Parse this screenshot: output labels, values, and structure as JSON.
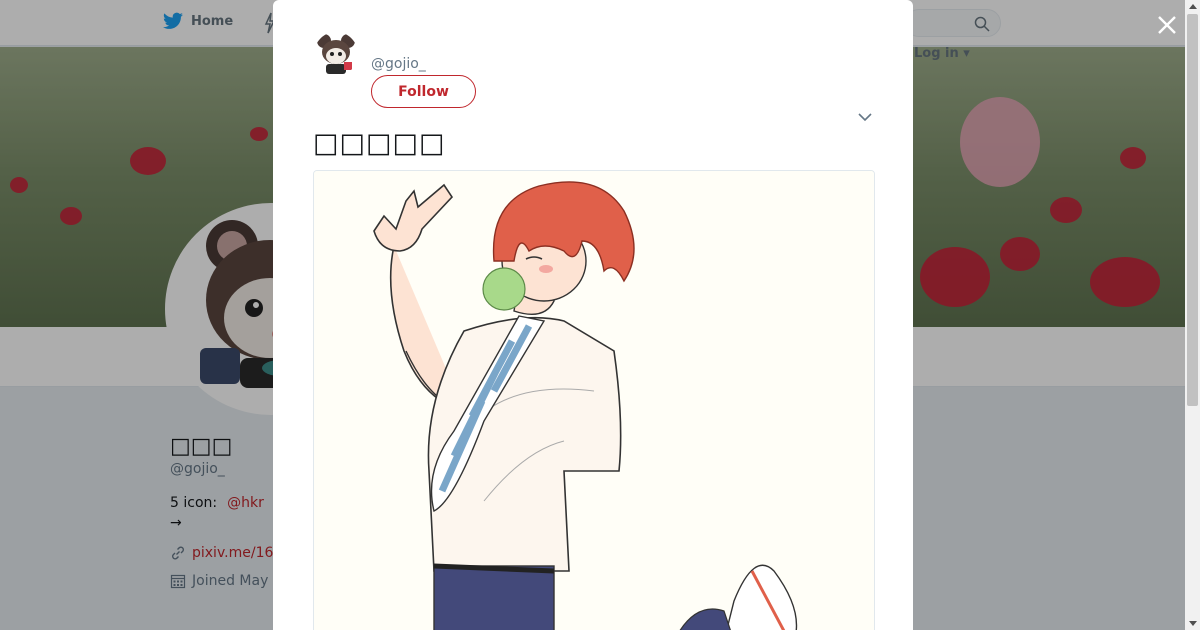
{
  "nav": {
    "home_label": "Home",
    "login_label": "Log in ▾"
  },
  "profile": {
    "name": "□□□",
    "handle": "@gojio_",
    "bio_prefix": "5 icon:",
    "bio_mention": "@hkr",
    "bio_arrow": "→",
    "link": "pixiv.me/16",
    "joined": "Joined May"
  },
  "tweet": {
    "handle": "@gojio_",
    "follow_label": "Follow",
    "text": "□□□□□"
  },
  "icons": {
    "home": "twitter-bird-icon",
    "moments": "lightning-icon",
    "search": "magnifier-icon",
    "link": "link-icon",
    "calendar": "calendar-icon",
    "close": "close-x-icon",
    "more": "chevron-down-icon"
  },
  "colors": {
    "accent": "#c0272d",
    "twitter_blue": "#1da1f2",
    "muted": "#657786"
  }
}
